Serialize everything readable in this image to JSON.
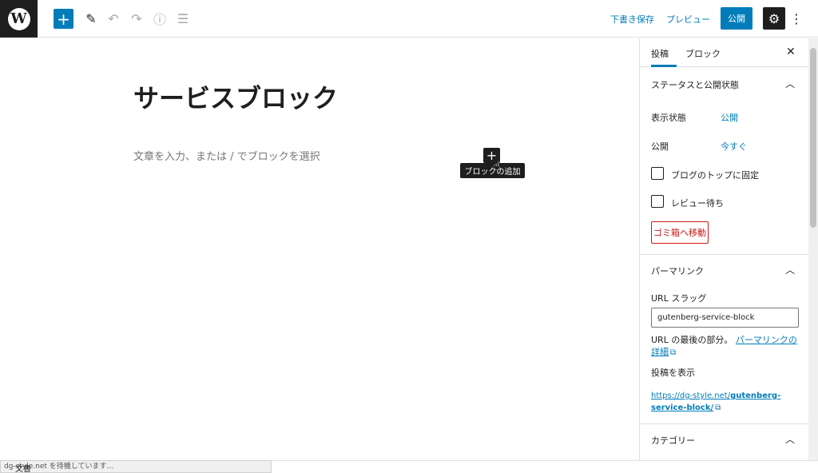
{
  "toolbar": {
    "logo_text": "W",
    "add_symbol": "+",
    "tools_icon": "✎",
    "undo_icon": "↶",
    "redo_icon": "↷",
    "info_icon": "ⓘ",
    "outline_icon": "☰",
    "save_draft": "下書き保存",
    "preview": "プレビュー",
    "publish": "公開",
    "settings_icon": "⚙",
    "more_icon": "⋮"
  },
  "editor": {
    "title": "サービスブロック",
    "placeholder": "文章を入力、または / でブロックを選択",
    "inline_add_symbol": "+",
    "tooltip": "ブロックの追加",
    "cursor_icon": "☝"
  },
  "sidebar": {
    "tabs": [
      "投稿",
      "ブロック"
    ],
    "close_icon": "✕",
    "status_panel": {
      "title": "ステータスと公開状態",
      "chevron": "︿",
      "visibility_label": "表示状態",
      "visibility_value": "公開",
      "publish_label": "公開",
      "publish_value": "今すぐ",
      "sticky_label": "ブログのトップに固定",
      "pending_label": "レビュー待ち",
      "trash": "ゴミ箱へ移動"
    },
    "permalink_panel": {
      "title": "パーマリンク",
      "chevron": "︿",
      "slug_label": "URL スラッグ",
      "slug_value": "gutenberg-service-block",
      "help_text": "URL の最後の部分。",
      "help_link": "パーマリンクの詳細",
      "view_label": "投稿を表示",
      "view_link_prefix": "https://dg-style.net/",
      "view_link_slug": "gutenberg-service-block/",
      "ext_icon": "⧉"
    },
    "category_panel": {
      "title": "カテゴリー",
      "chevron": "︿"
    }
  },
  "status": {
    "bubble_text": "dg-style.net を待機しています...",
    "doc_label": "文書"
  }
}
